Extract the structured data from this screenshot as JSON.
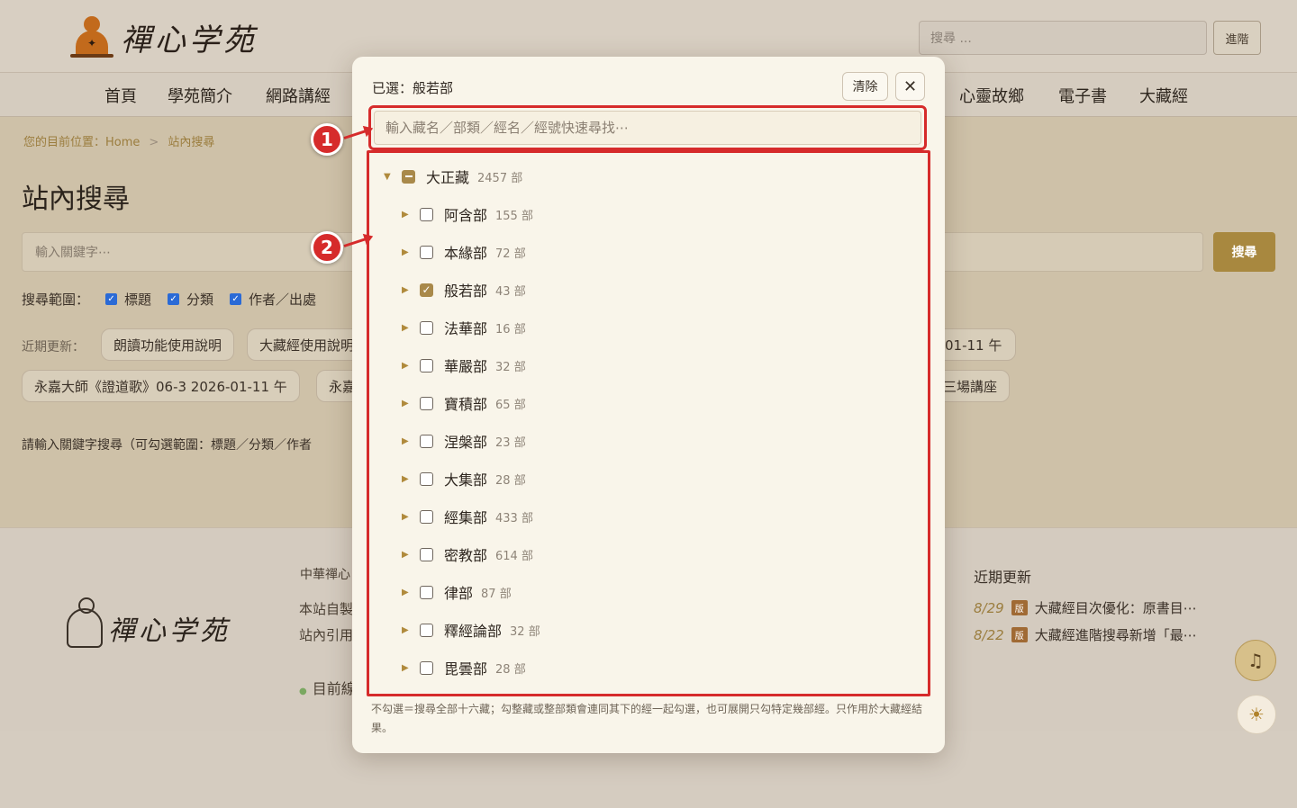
{
  "header": {
    "logo_text": "禪心学苑",
    "search_placeholder": "搜尋 ...",
    "advanced_label": "進階"
  },
  "nav": [
    "首頁",
    "學苑簡介",
    "網路講經",
    "心靈故鄉",
    "電子書",
    "大藏經"
  ],
  "breadcrumb": {
    "prefix": "您的目前位置：",
    "home": "Home",
    "sep": ">",
    "current": "站內搜尋"
  },
  "page": {
    "title": "站內搜尋",
    "keyword_placeholder": "輸入關鍵字⋯",
    "search_button": "搜尋",
    "scope_label": "搜尋範圍：",
    "scope_options": [
      "標題",
      "分類",
      "作者／出處"
    ],
    "recent_label": "近期更新：",
    "chips_row1": [
      "朗讀功能使用說明",
      "大藏經使用說明",
      "01-11 午"
    ],
    "chips_row2": [
      "永嘉大師《證道歌》06-3 2026-01-11 午",
      "永嘉",
      "三場講座"
    ],
    "hint": "請輸入關鍵字搜尋（可勾選範圍：標題／分類／作者"
  },
  "footer": {
    "logo_text": "禪心学苑",
    "col_title": "中華禪心",
    "col_lines": [
      "本站自製",
      "站內引用"
    ],
    "status": "目前線",
    "recent_title": "近期更新",
    "recent_items": [
      {
        "date": "8/29",
        "badge": "版",
        "text": "大藏經目次優化：原書目⋯"
      },
      {
        "date": "8/22",
        "badge": "版",
        "text": "大藏經進階搜尋新增「最⋯"
      }
    ]
  },
  "modal": {
    "selected_label": "已選：般若部",
    "clear_label": "清除",
    "close_symbol": "✕",
    "filter_placeholder": "輸入藏名／部類／經名／經號快速尋找⋯",
    "root": {
      "name": "大正藏",
      "count": "2457 部",
      "state": "mixed",
      "expanded": true
    },
    "items": [
      {
        "name": "阿含部",
        "count": "155 部",
        "checked": false
      },
      {
        "name": "本緣部",
        "count": "72 部",
        "checked": false
      },
      {
        "name": "般若部",
        "count": "43 部",
        "checked": true
      },
      {
        "name": "法華部",
        "count": "16 部",
        "checked": false
      },
      {
        "name": "華嚴部",
        "count": "32 部",
        "checked": false
      },
      {
        "name": "寶積部",
        "count": "65 部",
        "checked": false
      },
      {
        "name": "涅槃部",
        "count": "23 部",
        "checked": false
      },
      {
        "name": "大集部",
        "count": "28 部",
        "checked": false
      },
      {
        "name": "經集部",
        "count": "433 部",
        "checked": false
      },
      {
        "name": "密教部",
        "count": "614 部",
        "checked": false
      },
      {
        "name": "律部",
        "count": "87 部",
        "checked": false
      },
      {
        "name": "釋經論部",
        "count": "32 部",
        "checked": false
      },
      {
        "name": "毘曇部",
        "count": "28 部",
        "checked": false
      }
    ],
    "note": "不勾選＝搜尋全部十六藏；勾整藏或整部類會連同其下的經一起勾選，也可展開只勾特定幾部經。只作用於大藏經結果。"
  },
  "annotations": [
    "1",
    "2"
  ],
  "colors": {
    "accent": "#a8883f",
    "annotation": "#d62b2b"
  }
}
